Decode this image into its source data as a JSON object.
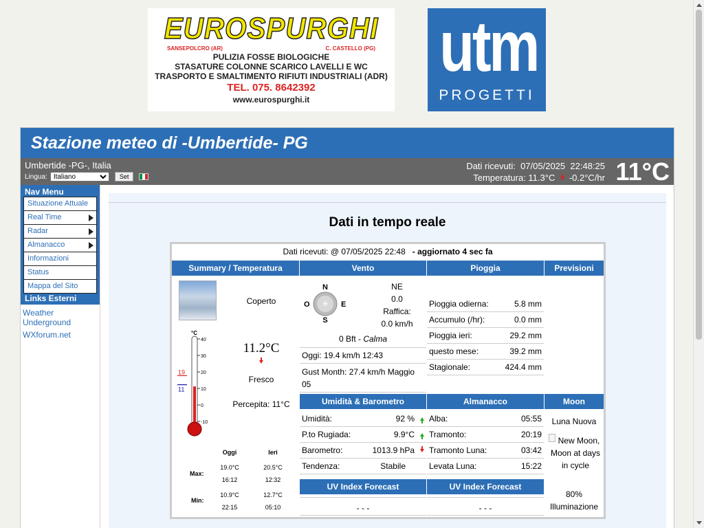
{
  "banners": {
    "eurospurghi": {
      "title": "EUROSPURGHI",
      "loc_left": "SANSEPOLCRO (AR)",
      "loc_right": "C. CASTELLO (PG)",
      "line1": "PULIZIA FOSSE BIOLOGICHE",
      "line2": "STASATURE COLONNE SCARICO LAVELLI E WC",
      "line3": "TRASPORTO E SMALTIMENTO RIFIUTI INDUSTRIALI (ADR)",
      "tel": "TEL. 075. 8642392",
      "web": "www.eurospurghi.it"
    },
    "utm": {
      "title": "utm",
      "subtitle": "PROGETTI"
    }
  },
  "header": {
    "title": "Stazione meteo di -Umbertide- PG"
  },
  "infobar": {
    "location": "Umbertide -PG-, Italia",
    "lang_label": "Lingua:",
    "lang_value": "Italiano",
    "set_label": "Set",
    "received_label": "Dati ricevuti:",
    "received_date": "07/05/2025",
    "received_time": "22:48:25",
    "temp_line": "Temperatura: 11.3°C",
    "temp_trend": "-0.2°C/hr",
    "big_temp": "11°C"
  },
  "sidebar": {
    "nav_heading": "Nav Menu",
    "items": [
      {
        "label": "Situazione Attuale",
        "submenu": false
      },
      {
        "label": "Real Time",
        "submenu": true
      },
      {
        "label": "Radar",
        "submenu": true
      },
      {
        "label": "Almanacco",
        "submenu": true
      },
      {
        "label": "Informazioni",
        "submenu": false
      },
      {
        "label": "Status",
        "submenu": false
      },
      {
        "label": "Mappa del Sito",
        "submenu": false
      }
    ],
    "links_heading": "Links Esterni",
    "links": [
      "Weather Underground",
      "WXforum.net"
    ]
  },
  "main": {
    "title": "Dati in tempo reale",
    "received_prefix": "Dati ricevuti: @ 07/05/2025 22:48",
    "updated": "- aggiornato 4 sec fa",
    "headers": {
      "summary": "Summary / Temperatura",
      "wind": "Vento",
      "rain": "Pioggia",
      "forecast": "Previsioni",
      "humidity": "Umidità & Barometro",
      "almanac": "Almanacco",
      "moon": "Moon",
      "uv1": "UV Index Forecast",
      "uv2": "UV Index Forecast"
    },
    "summary": {
      "condition": "Coperto",
      "temperature": "11.2°C",
      "feel": "Fresco",
      "perceived": "Percepita: 11°C",
      "thermo_unit": "°C",
      "thermo_ticks": [
        "40",
        "30",
        "20",
        "10",
        "0",
        "-10"
      ],
      "thermo_max": "19",
      "thermo_min": "11",
      "thermo_level_c": 11.2,
      "table": {
        "col_today": "Oggi",
        "col_yesterday": "Ieri",
        "max_label": "Max:",
        "min_label": "Min:",
        "max_today": "19.0°C",
        "max_today_time": "16:12",
        "max_yesterday": "20.5°C",
        "max_yesterday_time": "12:32",
        "min_today": "10.9°C",
        "min_today_time": "22:15",
        "min_yesterday": "12.7°C",
        "min_yesterday_time": "05:10"
      }
    },
    "wind": {
      "compass": {
        "n": "N",
        "s": "S",
        "e": "E",
        "o": "O"
      },
      "direction": "NE",
      "speed": "0.0",
      "gust_label": "Raffica:",
      "gust": "0.0 km/h",
      "bft": "0 Bft - ",
      "bft_desc": "Calma",
      "today": "Oggi: 19.4 km/h 12:43",
      "gust_month": "Gust Month: 27.4 km/h Maggio 05"
    },
    "rain": [
      {
        "label": "Pioggia odierna:",
        "value": "5.8 mm"
      },
      {
        "label": "Accumulo (/hr):",
        "value": "0.0 mm"
      },
      {
        "label": "Pioggia ieri:",
        "value": "29.2 mm"
      },
      {
        "label": "questo mese:",
        "value": "39.2 mm"
      },
      {
        "label": "Stagionale:",
        "value": "424.4 mm"
      }
    ],
    "humidity": [
      {
        "label": "Umidità:",
        "value": "92 %",
        "trend": "up"
      },
      {
        "label": "P.to Rugiada:",
        "value": "9.9°C",
        "trend": "up"
      },
      {
        "label": "Barometro:",
        "value": "1013.9 hPa",
        "trend": "down"
      },
      {
        "label": "Tendenza:",
        "value": "Stabile",
        "trend": "none"
      }
    ],
    "almanac": [
      {
        "label": "Alba:",
        "value": "05:55"
      },
      {
        "label": "Tramonto:",
        "value": "20:19"
      },
      {
        "label": "Tramonto Luna:",
        "value": "03:42"
      },
      {
        "label": "Levata Luna:",
        "value": "15:22"
      }
    ],
    "moon": {
      "phase": "Luna Nuova",
      "img_alt": "New Moon, Moon at days in cycle",
      "illumination": "80%",
      "illum_label": "Illuminazione"
    },
    "uv1_value": "- - -",
    "uv2_value": "- - -"
  },
  "colors": {
    "accent": "#2d6fb6",
    "infobar": "#666666",
    "trend_down": "#dd2222",
    "trend_up": "#22aa22"
  }
}
